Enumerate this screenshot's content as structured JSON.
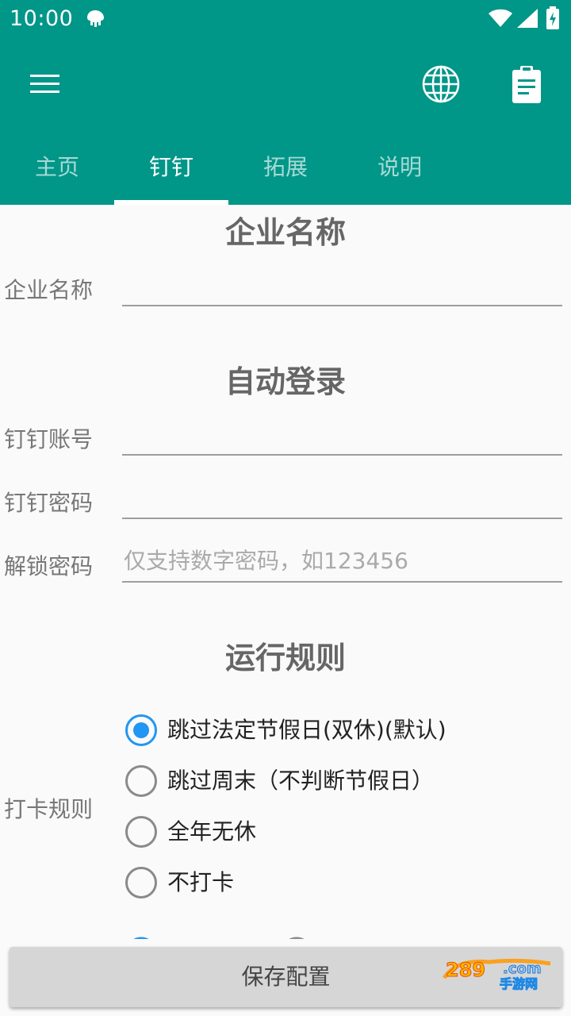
{
  "status_bar": {
    "time": "10:00"
  },
  "appbar": {
    "tabs": [
      {
        "label": "主页"
      },
      {
        "label": "钉钉"
      },
      {
        "label": "拓展"
      },
      {
        "label": "说明"
      }
    ],
    "active_tab": "钉钉",
    "colors": {
      "primary": "#009688",
      "accent": "#2196f3"
    }
  },
  "sections": {
    "company": {
      "title": "企业名称",
      "field_label": "企业名称",
      "field_value": ""
    },
    "auto_login": {
      "title": "自动登录",
      "account_label": "钉钉账号",
      "account_value": "",
      "password_label": "钉钉密码",
      "password_value": "",
      "unlock_label": "解锁密码",
      "unlock_placeholder": "仅支持数字密码，如123456"
    },
    "rules": {
      "title": "运行规则",
      "punch_label": "打卡规则",
      "options": [
        {
          "label": "跳过法定节假日(双休)(默认)",
          "checked": true
        },
        {
          "label": "跳过周末（不判断节假日）",
          "checked": false
        },
        {
          "label": "全年无休",
          "checked": false
        },
        {
          "label": "不打卡",
          "checked": false
        }
      ]
    }
  },
  "footer": {
    "save_label": "保存配置"
  },
  "watermark": {
    "text": "手游网"
  }
}
